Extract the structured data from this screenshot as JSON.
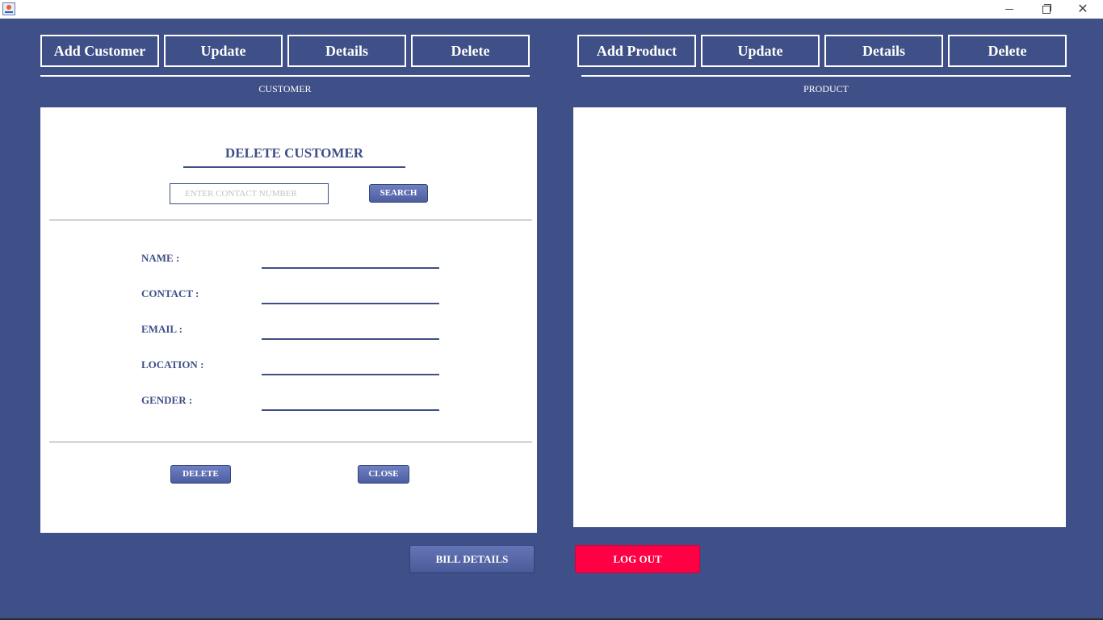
{
  "customer_tabs": [
    "Add Customer",
    "Update",
    "Details",
    "Delete"
  ],
  "product_tabs": [
    "Add Product",
    "Update",
    "Details",
    "Delete"
  ],
  "customer_section_label": "CUSTOMER",
  "product_section_label": "PRODUCT",
  "delete_form": {
    "title": "DELETE CUSTOMER",
    "search_placeholder": "ENTER CONTACT NUMBER",
    "search_value": "",
    "search_button": "SEARCH",
    "fields": [
      {
        "label": "NAME :",
        "value": ""
      },
      {
        "label": "CONTACT :",
        "value": ""
      },
      {
        "label": "EMAIL :",
        "value": ""
      },
      {
        "label": "LOCATION :",
        "value": ""
      },
      {
        "label": "GENDER :",
        "value": ""
      }
    ],
    "delete_button": "DELETE",
    "close_button": "CLOSE"
  },
  "bottom": {
    "bill_details": "BILL DETAILS",
    "logout": "LOG OUT"
  },
  "window": {
    "close_glyph": "✕"
  },
  "colors": {
    "background": "#3f4f87",
    "accent": "#5a6bb0",
    "logout": "#ff0044"
  }
}
